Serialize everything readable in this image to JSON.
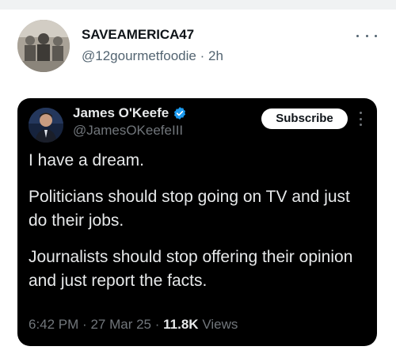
{
  "post": {
    "display_name": "SAVEAMERICA47",
    "handle": "@12gourmetfoodie",
    "separator": "·",
    "time_ago": "2h"
  },
  "embedded": {
    "display_name": "James O'Keefe",
    "handle": "@JamesOKeefeIII",
    "subscribe_label": "Subscribe",
    "paragraphs": [
      "I have a dream.",
      "Politicians should stop going on TV and just do their jobs.",
      "Journalists should stop offering their opinion and just report the facts."
    ],
    "time": "6:42 PM",
    "separator": "·",
    "date": "27 Mar 25",
    "views_count": "11.8K",
    "views_label": "Views"
  },
  "colors": {
    "verified_badge": "#1d9bf0",
    "embed_bg": "#000000",
    "subscribe_bg": "#ffffff"
  },
  "icons": [
    "more-horizontal-icon",
    "verified-badge-icon",
    "more-vertical-icon"
  ]
}
